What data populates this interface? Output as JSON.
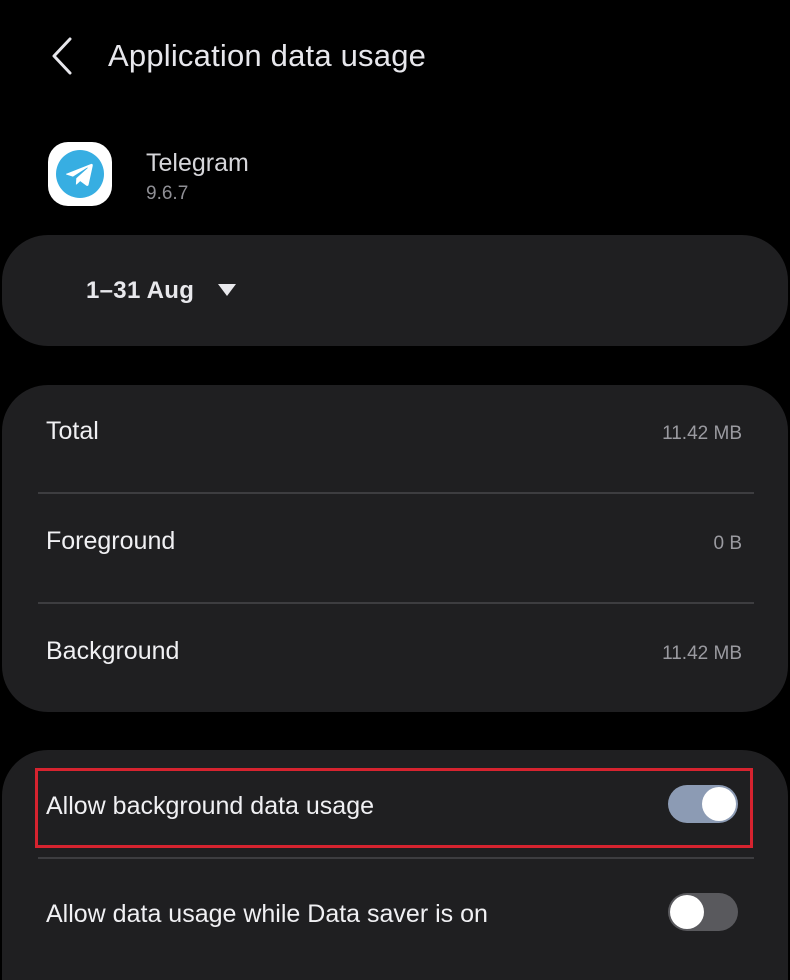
{
  "header": {
    "title": "Application data usage",
    "back_icon": "chevron-left-icon"
  },
  "app": {
    "name": "Telegram",
    "version": "9.6.7",
    "icon": "telegram-icon",
    "icon_color": "#37aee2"
  },
  "date_range": {
    "label": "1–31 Aug",
    "dropdown_icon": "caret-down-icon"
  },
  "usage": {
    "rows": [
      {
        "label": "Total",
        "value": "11.42 MB"
      },
      {
        "label": "Foreground",
        "value": "0 B"
      },
      {
        "label": "Background",
        "value": "11.42 MB"
      }
    ]
  },
  "toggles": [
    {
      "label": "Allow background data usage",
      "checked": true,
      "highlighted": true
    },
    {
      "label": "Allow data usage while Data saver is on",
      "checked": false
    }
  ],
  "colors": {
    "background": "#000000",
    "card": "#1f1f21",
    "switch_on": "#8c9bb4",
    "switch_off": "#59595d",
    "highlight": "#d6232f"
  }
}
